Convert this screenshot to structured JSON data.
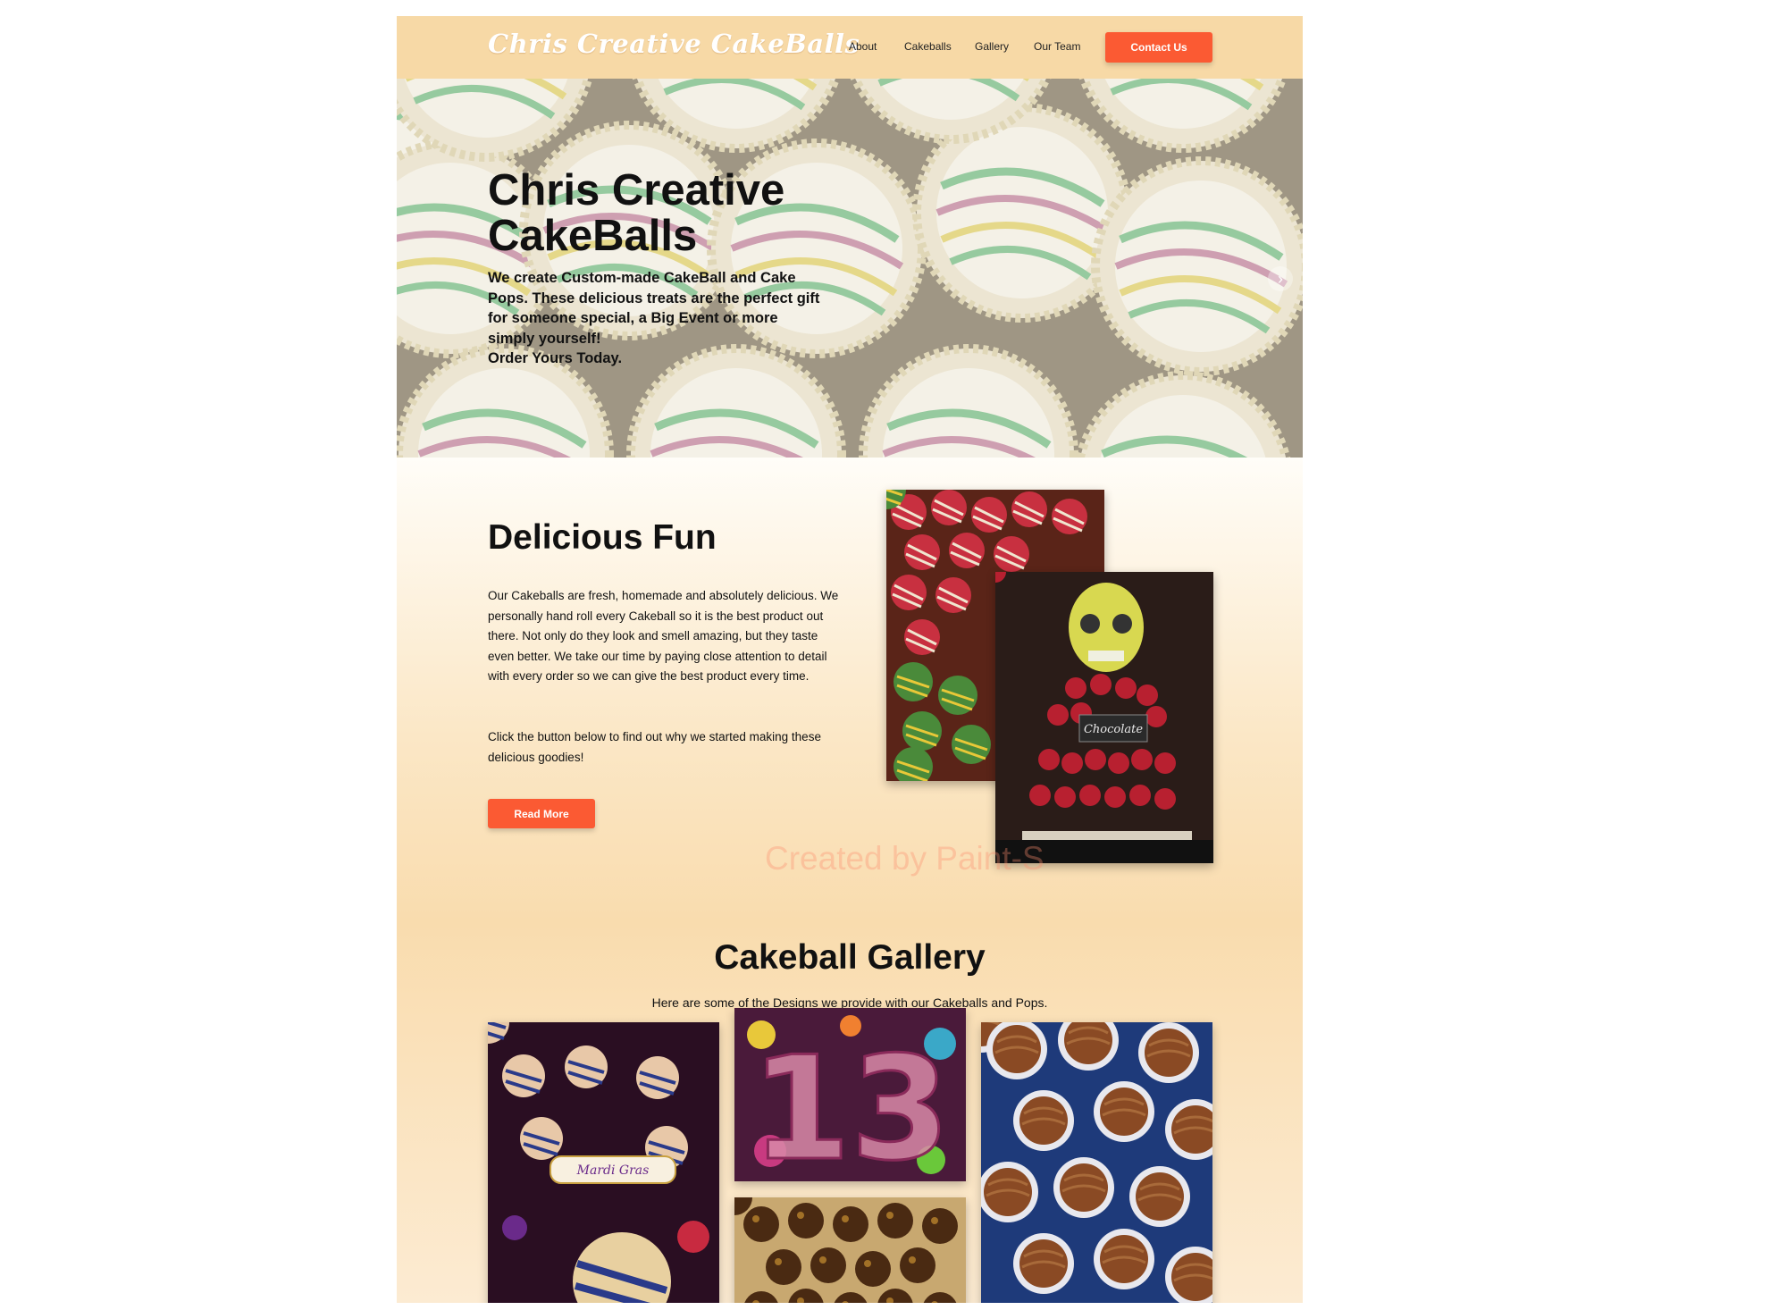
{
  "header": {
    "logo": "Chris Creative CakeBalls",
    "nav": [
      "About",
      "Cakeballs",
      "Gallery",
      "Our Team"
    ],
    "contact_button": "Contact Us"
  },
  "hero": {
    "title": "Chris Creative CakeBalls",
    "text_line1": "We create Custom-made CakeBall and Cake Pops. These delicious treats are the perfect gift for someone special, a Big Event or more simply yourself!",
    "text_line2": "Order Yours Today.",
    "next_icon": "chevron-right-icon"
  },
  "about": {
    "title": "Delicious Fun",
    "paragraph1": "Our Cakeballs are fresh, homemade and absolutely delicious. We personally hand roll every Cakeball so it is the best product out there. Not only do they look and smell amazing, but they taste even better. We take our time by paying close attention to detail with every order so we can give the best product every time.",
    "paragraph2": "Click the button below to find out why we started making these delicious goodies!",
    "button": "Read More",
    "photo2_sign": "Chocolate",
    "watermark": "Created by Paint-S"
  },
  "gallery": {
    "title": "Cakeball Gallery",
    "subtitle": "Here are some of the Designs we provide with our Cakeballs and Pops.",
    "image2_number": "13",
    "image1_banner": "Mardi Gras"
  },
  "colors": {
    "accent": "#fb5a33",
    "header_bg": "#f7d9a6",
    "page_bg": "#fdf3e4"
  }
}
